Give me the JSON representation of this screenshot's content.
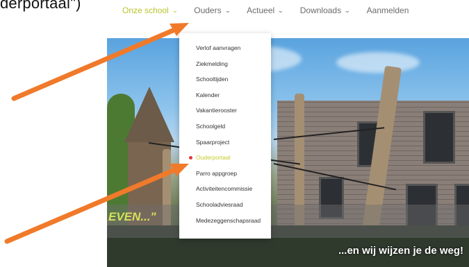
{
  "doc_fragment": "derportaal\")",
  "nav": {
    "items": [
      {
        "label": "Onze school",
        "has_chevron": true,
        "active": true
      },
      {
        "label": "Ouders",
        "has_chevron": true,
        "active": false
      },
      {
        "label": "Actueel",
        "has_chevron": true,
        "active": false
      },
      {
        "label": "Downloads",
        "has_chevron": true,
        "active": false
      },
      {
        "label": "Aanmelden",
        "has_chevron": false,
        "active": false
      }
    ],
    "chevron_glyph": "⌄"
  },
  "dropdown": {
    "items": [
      {
        "label": "Verlof aanvragen"
      },
      {
        "label": "Ziekmelding"
      },
      {
        "label": "Schooltijden"
      },
      {
        "label": "Kalender"
      },
      {
        "label": "Vakantierooster"
      },
      {
        "label": "Schoolgeld"
      },
      {
        "label": "Spaarproject"
      },
      {
        "label": "Ouderportaal",
        "active": true
      },
      {
        "label": "Parro appgroep"
      },
      {
        "label": "Activiteitencommissie"
      },
      {
        "label": "Schooladviesraad"
      },
      {
        "label": "Medezeggenschapsraad"
      }
    ]
  },
  "hero": {
    "caption_left": "EVEN...\"",
    "caption_right": "...en wij wijzen je de weg!"
  },
  "colors": {
    "accent": "#b8c42a",
    "arrow": "#f07a2a",
    "active_dot": "#e03a3a"
  }
}
